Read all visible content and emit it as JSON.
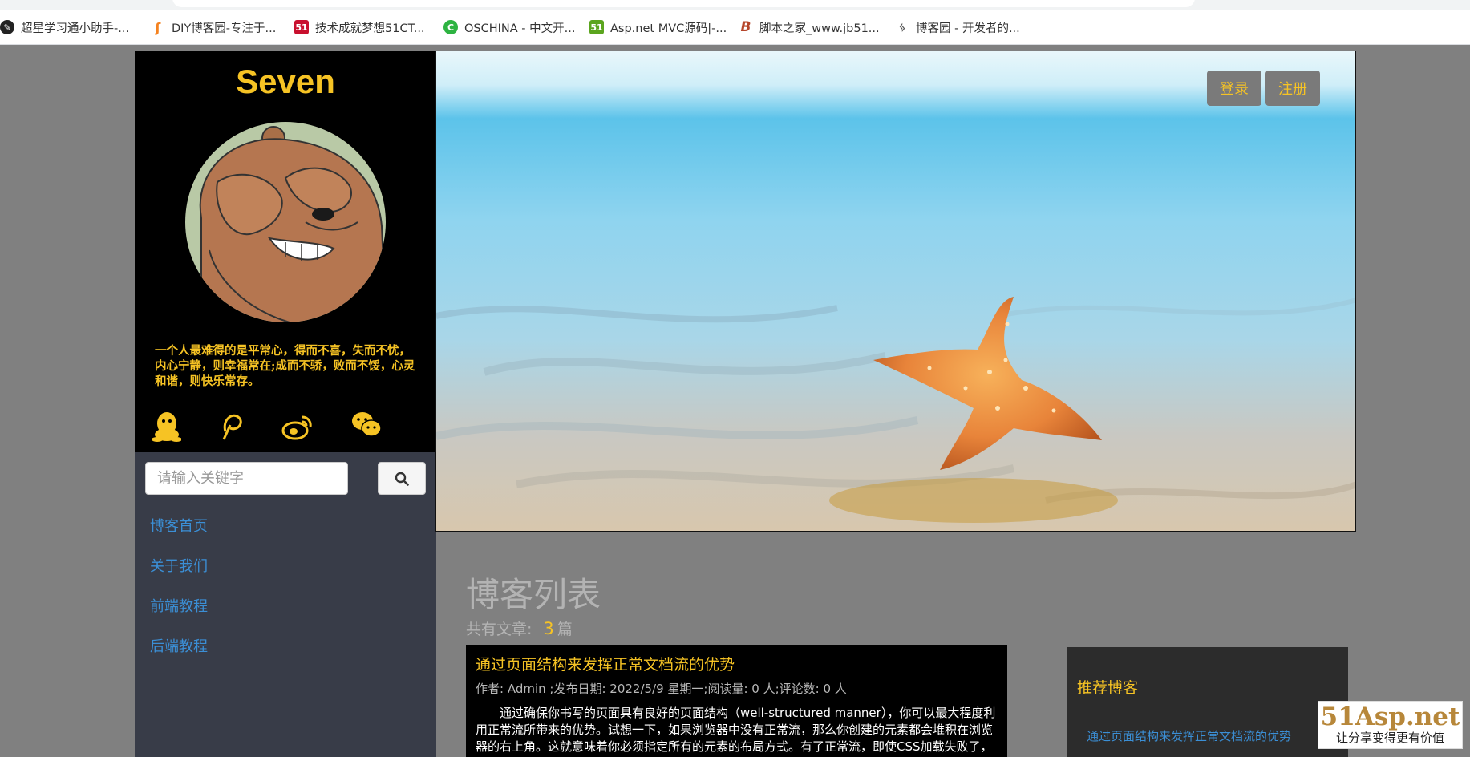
{
  "bookmarks": [
    {
      "label": "超星学习通小助手-...",
      "icon": "chaoxing-icon",
      "color": "#222222"
    },
    {
      "label": "DIY博客园-专注于...",
      "icon": "diy-blog-icon",
      "color": "#f5821f"
    },
    {
      "label": "技术成就梦想51CT...",
      "icon": "51cto-icon",
      "color": "#c8102e"
    },
    {
      "label": "OSCHINA - 中文开...",
      "icon": "oschina-icon",
      "color": "#2db341"
    },
    {
      "label": "Asp.net MVC源码|-...",
      "icon": "51aspx-icon",
      "color": "#5ba51e"
    },
    {
      "label": "脚本之家_www.jb51...",
      "icon": "jb51-icon",
      "color": "#b5452a"
    },
    {
      "label": "博客园 - 开发者的...",
      "icon": "cnblogs-icon",
      "color": "#555555"
    }
  ],
  "sidebar": {
    "brand": "Seven",
    "motto": "一个人最难得的是平常心，得而不喜，失而不忧，内心宁静，则幸福常在;成而不骄，败而不馁，心灵和谐，则快乐常存。",
    "social_icons": [
      "qq-icon",
      "weibo-pen-icon",
      "weibo-icon",
      "wechat-icon"
    ],
    "search": {
      "placeholder": "请输入关键字",
      "button_icon": "search-icon"
    },
    "nav": [
      {
        "label": "博客首页"
      },
      {
        "label": "关于我们"
      },
      {
        "label": "前端教程"
      },
      {
        "label": "后端教程"
      }
    ]
  },
  "header": {
    "login_label": "登录",
    "register_label": "注册"
  },
  "main": {
    "list_title": "博客列表",
    "count_prefix": "共有文章:",
    "count": "3",
    "count_unit": "篇",
    "articles": [
      {
        "title": "通过页面结构来发挥正常文档流的优势",
        "meta": "作者: Admin ;发布日期: 2022/5/9 星期一;阅读量: 0 人;评论数: 0 人",
        "body": "通过确保你书写的页面具有良好的页面结构（well-structured manner），你可以最大程度利用正常流所带来的优势。试想一下，如果浏览器中没有正常流，那么你创建的元素都会堆积在浏览器的右上角。这就意味着你必须指定所有的元素的布局方式。有了正常流，即使CSS加载失败了，用户仍然能阅读你的页面内容。同时，一些不使用CSS的工具（如一些阅读器）会按照元素在文档中的位置来读取页面内容。"
      }
    ]
  },
  "recommended": {
    "title": "推荐博客",
    "items": [
      "通过页面结构来发挥正常文档流的优势"
    ]
  },
  "watermark": {
    "brand": "51Asp.net",
    "slogan": "让分享变得更有价值"
  },
  "colors": {
    "accent": "#f6c324",
    "link": "#3b8fd6",
    "page_bg": "#808080",
    "sidebar_nav_bg": "#383c48"
  }
}
